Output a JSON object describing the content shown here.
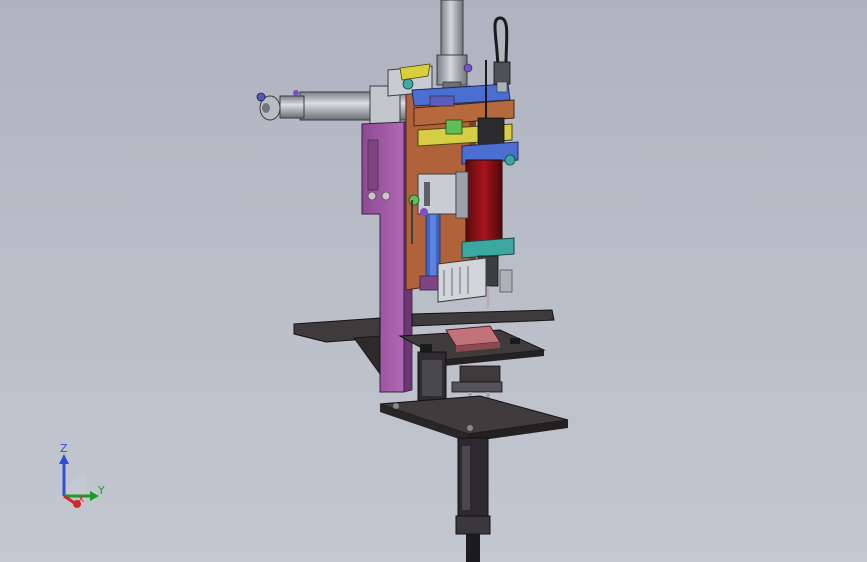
{
  "viewport": {
    "background_top": "#aeb3bf",
    "background_bottom": "#c3c7d0"
  },
  "triad": {
    "z_label": "Z",
    "y_label": "Y",
    "x_label": "X",
    "z_color": "#2e4fd6",
    "y_color": "#1e9a2a",
    "x_color": "#d2262a"
  },
  "model": {
    "part_colors": {
      "frame_plate": "#a45aa8",
      "base_plate": "#3f3a3c",
      "copper_block": "#b8683e",
      "cylinder_red": "#8e1218",
      "bracket_blue": "#4a6fd0",
      "bracket_yellow": "#d6cf45",
      "bracket_green": "#5fbf56",
      "bracket_teal": "#3aa7a0",
      "pink_block": "#c2737a",
      "steel": "#9aa0a8"
    }
  }
}
